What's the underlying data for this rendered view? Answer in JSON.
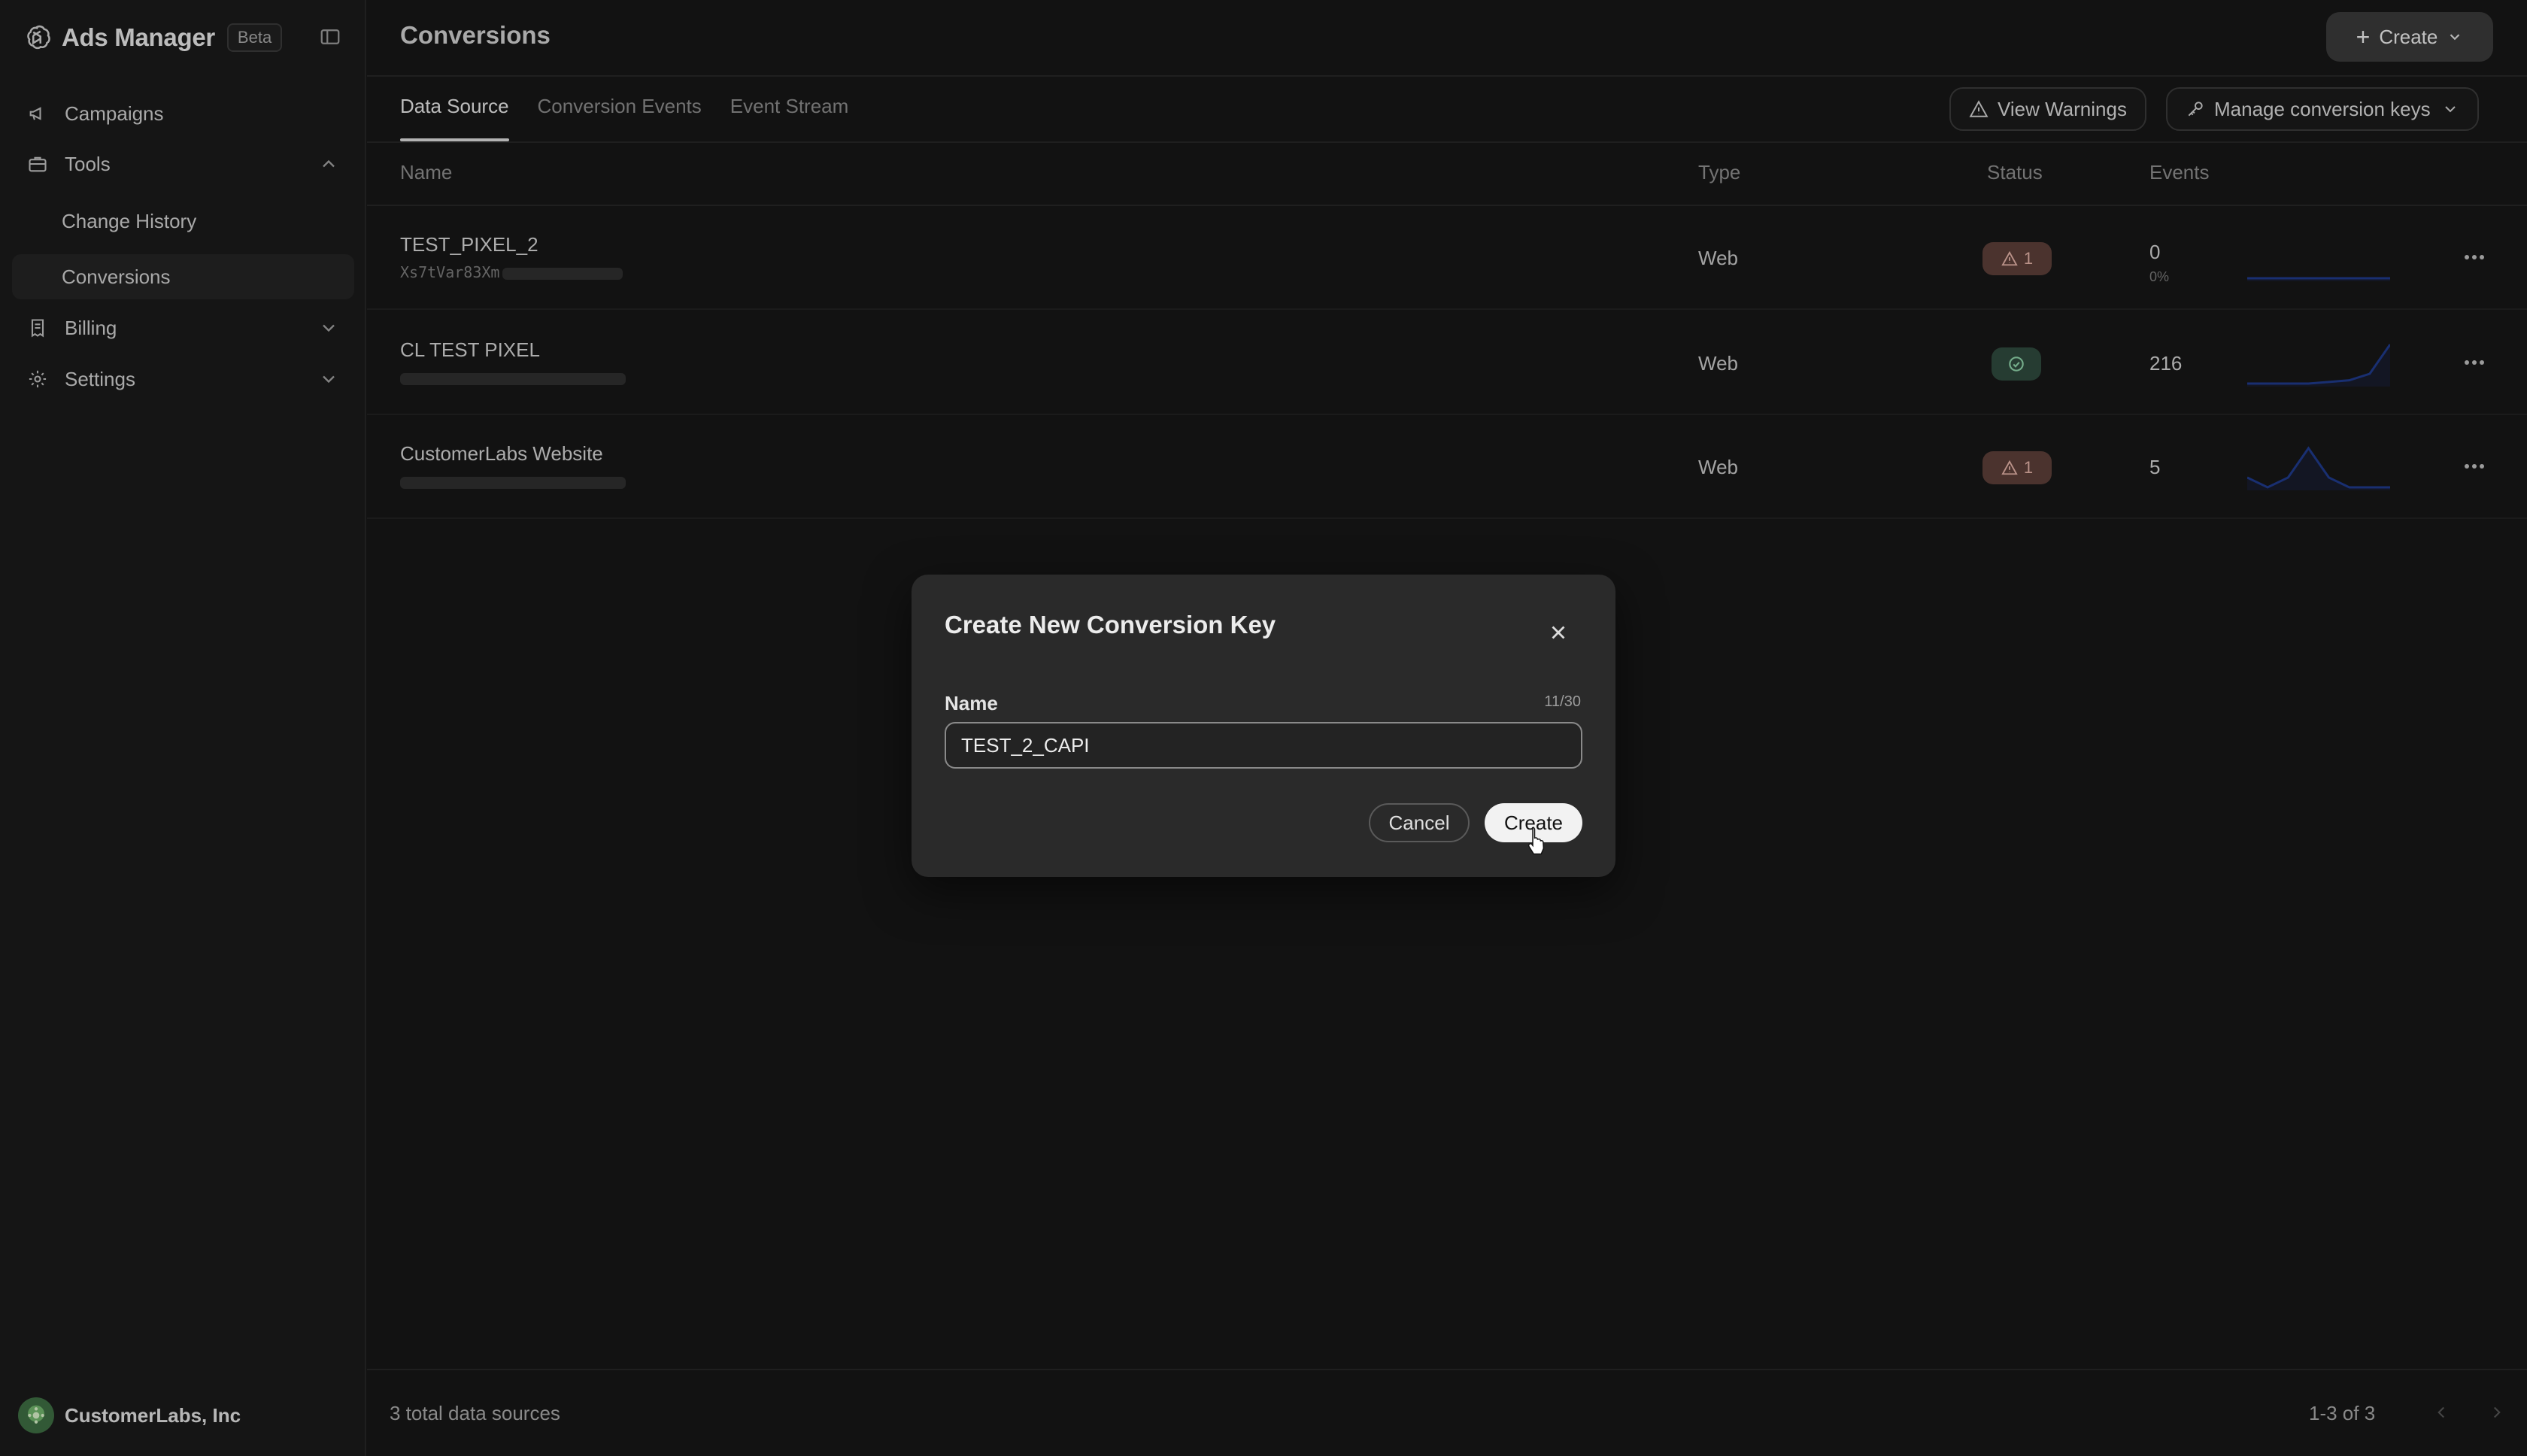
{
  "app": {
    "name": "Ads Manager",
    "badge": "Beta"
  },
  "sidebar": {
    "items": [
      {
        "label": "Campaigns",
        "icon": "megaphone-icon"
      },
      {
        "label": "Tools",
        "icon": "briefcase-icon",
        "expanded": true
      },
      {
        "label": "Change History",
        "sub": true
      },
      {
        "label": "Conversions",
        "sub": true,
        "active": true
      },
      {
        "label": "Billing",
        "icon": "receipt-icon",
        "expanded": false
      },
      {
        "label": "Settings",
        "icon": "gear-icon",
        "expanded": false
      }
    ],
    "org_name": "CustomerLabs, Inc"
  },
  "header": {
    "title": "Conversions",
    "create_label": "Create"
  },
  "tabs": [
    {
      "label": "Data Source",
      "active": true
    },
    {
      "label": "Conversion Events",
      "active": false
    },
    {
      "label": "Event Stream",
      "active": false
    }
  ],
  "actions": {
    "view_warnings": "View Warnings",
    "manage_keys": "Manage conversion keys"
  },
  "table": {
    "columns": [
      "Name",
      "Type",
      "Status",
      "Events"
    ],
    "rows": [
      {
        "name": "TEST_PIXEL_2",
        "key_visible": "Xs7tVar83Xm",
        "type": "Web",
        "status": "warning",
        "status_count": "1",
        "events": "0",
        "events_pct": "0%",
        "sparkline": [
          0,
          0,
          0,
          0,
          0,
          0,
          0,
          0
        ]
      },
      {
        "name": "CL TEST PIXEL",
        "key_visible": "",
        "type": "Web",
        "status": "ok",
        "status_count": "",
        "events": "216",
        "events_pct": "",
        "sparkline": [
          0,
          0,
          0,
          0,
          1,
          2,
          6,
          24
        ]
      },
      {
        "name": "CustomerLabs Website",
        "key_visible": "",
        "type": "Web",
        "status": "warning",
        "status_count": "1",
        "events": "5",
        "events_pct": "",
        "sparkline": [
          1,
          0,
          1,
          4,
          1,
          0,
          0,
          0
        ]
      }
    ]
  },
  "footer": {
    "total": "3 total data sources",
    "range": "1-3 of 3"
  },
  "modal": {
    "title": "Create New Conversion Key",
    "field_label": "Name",
    "char_count": "11/30",
    "field_value": "TEST_2_CAPI",
    "cancel_label": "Cancel",
    "create_label": "Create"
  },
  "colors": {
    "background": "#161616",
    "sidebar": "#1a1a1a",
    "modal": "#2a2a2a",
    "warning_badge": "#5c3f39",
    "ok_badge": "#2f4a3d",
    "sparkline": "#1f3a8a"
  }
}
